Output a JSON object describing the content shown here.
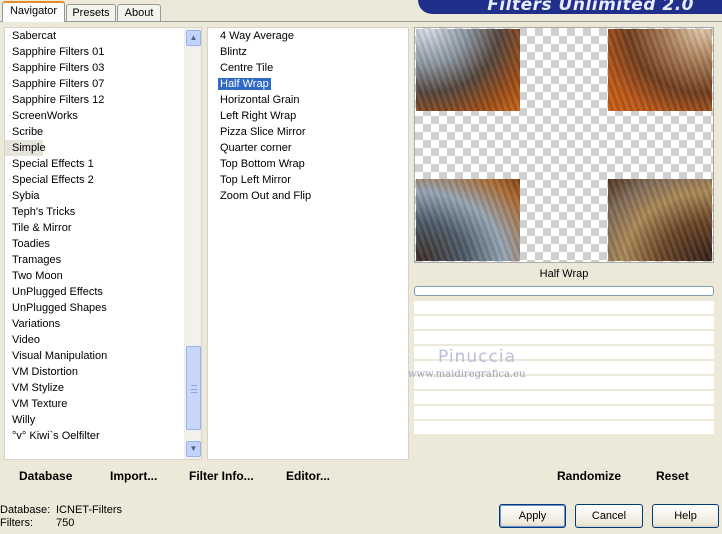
{
  "tabs": [
    {
      "label": "Navigator",
      "active": true
    },
    {
      "label": "Presets",
      "active": false
    },
    {
      "label": "About",
      "active": false
    }
  ],
  "banner_title": "Filters Unlimited 2.0",
  "categories": {
    "items": [
      "Sabercat",
      "Sapphire Filters 01",
      "Sapphire Filters 03",
      "Sapphire Filters 07",
      "Sapphire Filters 12",
      "ScreenWorks",
      "Scribe",
      "Simple",
      "Special Effects 1",
      "Special Effects 2",
      "Sybia",
      "Teph's Tricks",
      "Tile & Mirror",
      "Toadies",
      "Tramages",
      "Two Moon",
      "UnPlugged Effects",
      "UnPlugged Shapes",
      "Variations",
      "Video",
      "Visual Manipulation",
      "VM Distortion",
      "VM Stylize",
      "VM Texture",
      "Willy",
      "°v° Kiwi`s Oelfilter"
    ],
    "selected": "Simple"
  },
  "filters": {
    "items": [
      "4 Way Average",
      "Blintz",
      "Centre Tile",
      "Half Wrap",
      "Horizontal Grain",
      "Left Right Wrap",
      "Pizza Slice Mirror",
      "Quarter corner",
      "Top Bottom Wrap",
      "Top Left Mirror",
      "Zoom Out and Flip"
    ],
    "selected": "Half Wrap"
  },
  "preview": {
    "label": "Half Wrap",
    "progress": 0
  },
  "watermark": {
    "name": "Pinuccia",
    "url": "www.maidiregrafica.eu"
  },
  "toolbar": {
    "database": "Database",
    "import": "Import...",
    "filter_info": "Filter Info...",
    "editor": "Editor...",
    "randomize": "Randomize",
    "reset": "Reset"
  },
  "status": {
    "database_label": "Database:",
    "database_value": "ICNET-Filters",
    "filters_label": "Filters:",
    "filters_value": "750"
  },
  "buttons": {
    "apply": "Apply",
    "cancel": "Cancel",
    "help": "Help"
  }
}
